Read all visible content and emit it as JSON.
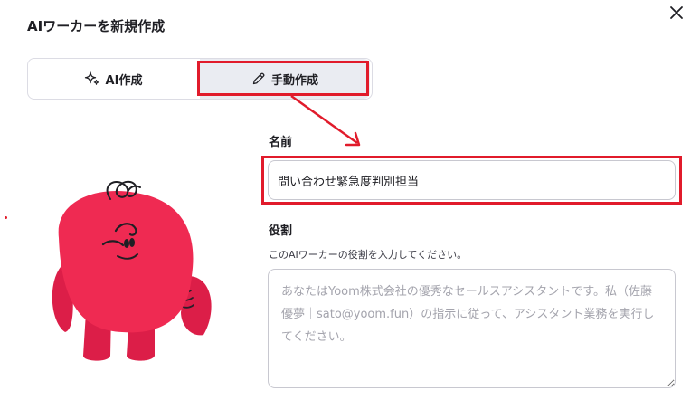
{
  "dialog": {
    "title": "AIワーカーを新規作成"
  },
  "mode_toggle": {
    "ai_label": "AI作成",
    "manual_label": "手動作成",
    "selected": "manual"
  },
  "form": {
    "name_label": "名前",
    "name_value": "問い合わせ緊急度判別担当",
    "role_label": "役割",
    "role_description": "このAIワーカーの役割を入力してください。",
    "role_placeholder": "あなたはYoom株式会社の優秀なセールスアシスタントです。私（佐藤優夢｜sato@yoom.fun）の指示に従って、アシスタント業務を実行してください。"
  },
  "colors": {
    "highlight": "#e11b2b",
    "mascot": "#ef2a52",
    "mascot_shadow": "#c8183e",
    "selected_bg": "#eaecf2"
  },
  "icons": [
    "close-icon",
    "sparkle-icon",
    "pencil-icon"
  ]
}
